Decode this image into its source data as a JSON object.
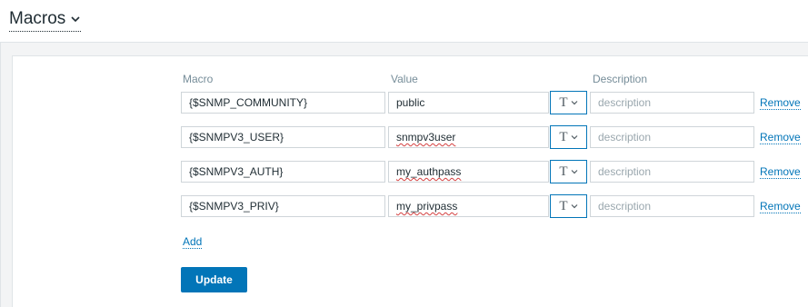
{
  "section": {
    "title": "Macros",
    "expander_icon": "chevron-down-icon"
  },
  "table": {
    "headers": {
      "macro": "Macro",
      "value": "Value",
      "description": "Description"
    },
    "rows": [
      {
        "macro": "{$SNMP_COMMUNITY}",
        "value": "public",
        "type_symbol": "T",
        "description_placeholder": "description",
        "remove_label": "Remove"
      },
      {
        "macro": "{$SNMPV3_USER}",
        "value": "snmpv3user",
        "type_symbol": "T",
        "description_placeholder": "description",
        "remove_label": "Remove"
      },
      {
        "macro": "{$SNMPV3_AUTH}",
        "value": "my_authpass",
        "type_symbol": "T",
        "description_placeholder": "description",
        "remove_label": "Remove"
      },
      {
        "macro": "{$SNMPV3_PRIV}",
        "value": "my_privpass",
        "type_symbol": "T",
        "description_placeholder": "description",
        "remove_label": "Remove"
      }
    ]
  },
  "actions": {
    "add_label": "Add",
    "update_label": "Update"
  },
  "colors": {
    "accent": "#0275b8",
    "panel_bg": "#f3f4f5",
    "text": "#1f2c33",
    "muted": "#768d99"
  }
}
